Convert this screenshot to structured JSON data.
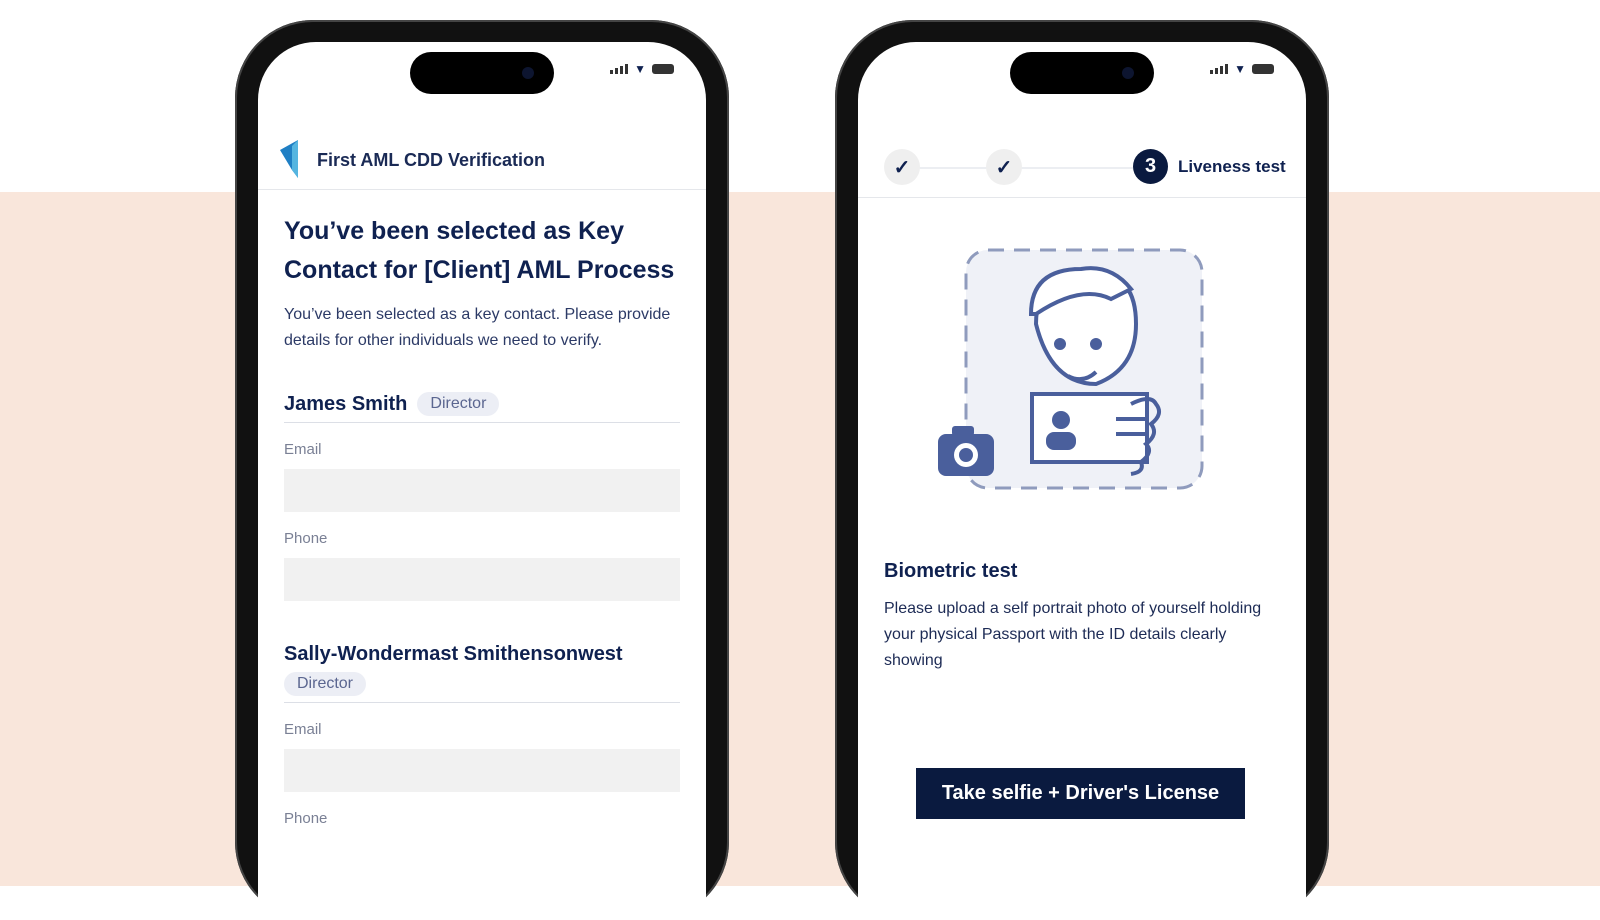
{
  "left": {
    "app_title": "First AML CDD Verification",
    "heading": "You’ve been selected as Key Contact for [Client] AML Process",
    "intro": "You’ve been selected as a key contact. Please provide details for other individuals we need to verify.",
    "people": [
      {
        "name": "James Smith",
        "role": "Director",
        "email_label": "Email",
        "phone_label": "Phone"
      },
      {
        "name": "Sally-Wondermast Smithensonwest",
        "role": "Director",
        "email_label": "Email",
        "phone_label": "Phone"
      }
    ]
  },
  "right": {
    "steps": [
      {
        "state": "done",
        "mark": "✓"
      },
      {
        "state": "done",
        "mark": "✓"
      },
      {
        "state": "current",
        "number": "3",
        "label": "Liveness test"
      }
    ],
    "title": "Biometric test",
    "description": "Please upload a self portrait photo of yourself holding your physical Passport with the ID details clearly showing",
    "button": "Take selfie + Driver's License"
  },
  "colors": {
    "navy": "#0a1a3f",
    "peach": "#f9e6db",
    "illustration": "#4a5f9c"
  }
}
